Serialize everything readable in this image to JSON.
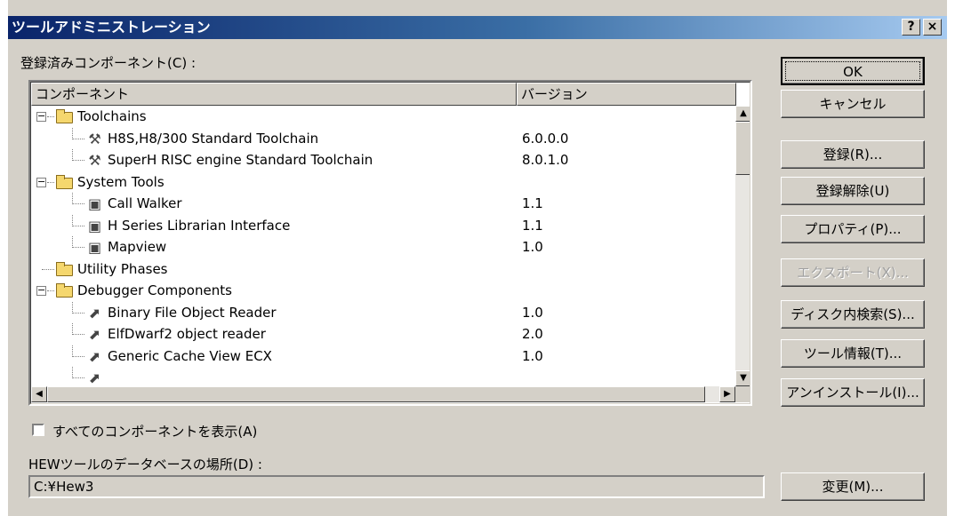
{
  "window": {
    "title": "ツールアドミニストレーション",
    "help_button": "?",
    "close_button": "×"
  },
  "components_label": "登録済みコンポーネント(C) :",
  "list": {
    "headers": {
      "component": "コンポーネント",
      "version": "バージョン"
    },
    "rows": [
      {
        "name": "Toolchains",
        "version": "",
        "type": "folder",
        "level": 0,
        "expander": "−"
      },
      {
        "name": "H8S,H8/300 Standard Toolchain",
        "version": "6.0.0.0",
        "type": "toolchain",
        "level": 1
      },
      {
        "name": "SuperH RISC engine Standard Toolchain",
        "version": "8.0.1.0",
        "type": "toolchain",
        "level": 1
      },
      {
        "name": "System Tools",
        "version": "",
        "type": "folder",
        "level": 0,
        "expander": "−"
      },
      {
        "name": "Call Walker",
        "version": "1.1",
        "type": "tool",
        "level": 1
      },
      {
        "name": "H Series Librarian Interface",
        "version": "1.1",
        "type": "tool",
        "level": 1
      },
      {
        "name": "Mapview",
        "version": "1.0",
        "type": "tool",
        "level": 1
      },
      {
        "name": "Utility Phases",
        "version": "",
        "type": "folder",
        "level": 0
      },
      {
        "name": "Debugger Components",
        "version": "",
        "type": "folder",
        "level": 0,
        "expander": "−"
      },
      {
        "name": "Binary File Object Reader",
        "version": "1.0",
        "type": "debug",
        "level": 1
      },
      {
        "name": "ElfDwarf2 object reader",
        "version": "2.0",
        "type": "debug",
        "level": 1
      },
      {
        "name": "Generic Cache View ECX",
        "version": "1.0",
        "type": "debug",
        "level": 1
      },
      {
        "name": "",
        "version": "",
        "type": "debug",
        "level": 1
      }
    ]
  },
  "buttons": {
    "ok": "OK",
    "cancel": "キャンセル",
    "register": "登録(R)...",
    "unregister": "登録解除(U)",
    "properties": "プロパティ(P)...",
    "export": "エクスポート(X)...",
    "disk_search": "ディスク内検索(S)...",
    "tool_info": "ツール情報(T)...",
    "uninstall": "アンインストール(I)...",
    "change": "変更(M)..."
  },
  "show_all_label": "すべてのコンポーネントを表示(A)",
  "db_location_label": "HEWツールのデータベースの場所(D) :",
  "db_path": "C:¥Hew3"
}
